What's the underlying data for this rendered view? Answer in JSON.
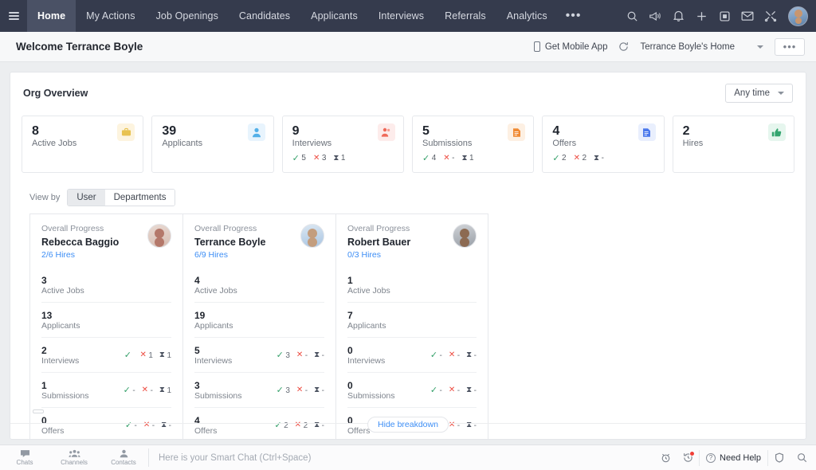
{
  "topnav": {
    "menu_icon": "hamburger-icon",
    "items": [
      {
        "label": "Home",
        "active": true
      },
      {
        "label": "My Actions",
        "active": false
      },
      {
        "label": "Job Openings",
        "active": false
      },
      {
        "label": "Candidates",
        "active": false
      },
      {
        "label": "Applicants",
        "active": false
      },
      {
        "label": "Interviews",
        "active": false
      },
      {
        "label": "Referrals",
        "active": false
      },
      {
        "label": "Analytics",
        "active": false
      }
    ],
    "overflow_label": "•••",
    "icons": [
      "search-icon",
      "announcement-icon",
      "bell-icon",
      "plus-icon",
      "notes-icon",
      "mail-icon",
      "tools-icon"
    ],
    "avatar": "user-avatar"
  },
  "welcomebar": {
    "title": "Welcome Terrance Boyle",
    "mobile_app_label": "Get Mobile App",
    "refresh_icon": "refresh-icon",
    "home_label": "Terrance Boyle's Home",
    "more_label": "•••"
  },
  "panel": {
    "title": "Org Overview",
    "timefilter_label": "Any time"
  },
  "stats": [
    {
      "value": "8",
      "label": "Active Jobs",
      "icon": "briefcase-icon",
      "icon_bg": "#fdf4df",
      "icon_color": "#e8c250",
      "breakdown": null
    },
    {
      "value": "39",
      "label": "Applicants",
      "icon": "person-icon",
      "icon_bg": "#e8f4fd",
      "icon_color": "#54b0e8",
      "breakdown": null
    },
    {
      "value": "9",
      "label": "Interviews",
      "icon": "interview-icon",
      "icon_bg": "#fdeceb",
      "icon_color": "#ef6a5a",
      "breakdown": {
        "passed": "5",
        "failed": "3",
        "pending": "1"
      }
    },
    {
      "value": "5",
      "label": "Submissions",
      "icon": "document-icon",
      "icon_bg": "#fdf0e3",
      "icon_color": "#f08a33",
      "breakdown": {
        "passed": "4",
        "failed": "-",
        "pending": "1"
      }
    },
    {
      "value": "4",
      "label": "Offers",
      "icon": "offer-icon",
      "icon_bg": "#e9effd",
      "icon_color": "#4a78ec",
      "breakdown": {
        "passed": "2",
        "failed": "2",
        "pending": "-"
      }
    },
    {
      "value": "2",
      "label": "Hires",
      "icon": "thumbs-up-icon",
      "icon_bg": "#e6f6ee",
      "icon_color": "#34a56f",
      "breakdown": null
    }
  ],
  "viewby": {
    "label": "View by",
    "options": [
      {
        "label": "User",
        "selected": true
      },
      {
        "label": "Departments",
        "selected": false
      }
    ]
  },
  "usercards": [
    {
      "overall_label": "Overall Progress",
      "name": "Rebecca Baggio",
      "hires": "2/6 Hires",
      "avatar_class": "av1",
      "rows": [
        {
          "value": "3",
          "label": "Active Jobs",
          "breakdown": null
        },
        {
          "value": "13",
          "label": "Applicants",
          "breakdown": null
        },
        {
          "value": "2",
          "label": "Interviews",
          "breakdown": {
            "passed": "",
            "failed": "1",
            "pending": "1"
          }
        },
        {
          "value": "1",
          "label": "Submissions",
          "breakdown": {
            "passed": "-",
            "failed": "-",
            "pending": "1"
          }
        },
        {
          "value": "0",
          "label": "Offers",
          "breakdown": {
            "passed": "-",
            "failed": "-",
            "pending": "-"
          }
        }
      ]
    },
    {
      "overall_label": "Overall Progress",
      "name": "Terrance Boyle",
      "hires": "6/9 Hires",
      "avatar_class": "av2",
      "rows": [
        {
          "value": "4",
          "label": "Active Jobs",
          "breakdown": null
        },
        {
          "value": "19",
          "label": "Applicants",
          "breakdown": null
        },
        {
          "value": "5",
          "label": "Interviews",
          "breakdown": {
            "passed": "3",
            "failed": "-",
            "pending": "-"
          }
        },
        {
          "value": "3",
          "label": "Submissions",
          "breakdown": {
            "passed": "3",
            "failed": "-",
            "pending": "-"
          }
        },
        {
          "value": "4",
          "label": "Offers",
          "breakdown": {
            "passed": "2",
            "failed": "2",
            "pending": "-"
          }
        }
      ]
    },
    {
      "overall_label": "Overall Progress",
      "name": "Robert Bauer",
      "hires": "0/3 Hires",
      "avatar_class": "av3",
      "rows": [
        {
          "value": "1",
          "label": "Active Jobs",
          "breakdown": null
        },
        {
          "value": "7",
          "label": "Applicants",
          "breakdown": null
        },
        {
          "value": "0",
          "label": "Interviews",
          "breakdown": {
            "passed": "-",
            "failed": "-",
            "pending": "-"
          }
        },
        {
          "value": "0",
          "label": "Submissions",
          "breakdown": {
            "passed": "-",
            "failed": "-",
            "pending": "-"
          }
        },
        {
          "value": "0",
          "label": "Offers",
          "breakdown": {
            "passed": "-",
            "failed": "-",
            "pending": "-"
          }
        }
      ]
    }
  ],
  "hide_breakdown_label": "Hide breakdown",
  "footer": {
    "tabs": [
      {
        "label": "Chats",
        "icon": "chat-icon"
      },
      {
        "label": "Channels",
        "icon": "channels-icon"
      },
      {
        "label": "Contacts",
        "icon": "contacts-icon"
      }
    ],
    "chat_placeholder": "Here is your Smart Chat (Ctrl+Space)",
    "chat_value": "",
    "need_help_label": "Need Help",
    "right_icons": [
      "alarm-icon",
      "history-icon",
      "shield-icon",
      "search-icon"
    ]
  },
  "colors": {
    "nav_bg": "#353b4d",
    "accent_blue": "#3d8ef5",
    "success_green": "#35a06a",
    "danger_red": "#ed4c41"
  }
}
